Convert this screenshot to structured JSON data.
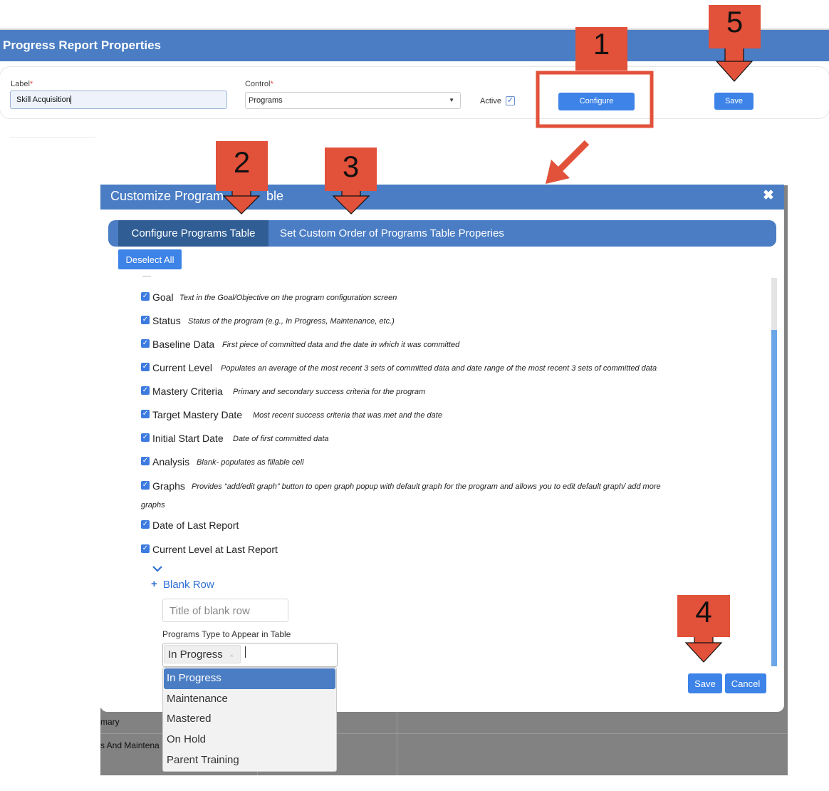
{
  "header": {
    "title": "Progress Report Properties"
  },
  "form": {
    "label_label": "Label",
    "label_value": "Skill Acquisition",
    "control_label": "Control",
    "control_value": "Programs",
    "required_mark": "*",
    "active_label": "Active",
    "active_checked": true,
    "configure_label": "Configure",
    "save_label": "Save"
  },
  "modal": {
    "title": "Customize Programs Table",
    "title_visible_left": "Customize Program",
    "title_visible_right": "ble",
    "close_glyph": "✖",
    "tabs": [
      {
        "label": "Configure Programs Table",
        "active": true
      },
      {
        "label": "Set Custom Order of Programs Table Properies",
        "active": false
      }
    ],
    "deselect_all_label": "Deselect All",
    "items": [
      {
        "name": "Goal",
        "desc": "Text in the Goal/Objective on the program configuration screen",
        "checked": true
      },
      {
        "name": "Status",
        "desc": "Status of the program (e.g., In Progress, Maintenance, etc.)",
        "checked": true
      },
      {
        "name": "Baseline Data",
        "desc": "First piece of committed data and the date in which it was committed",
        "checked": true
      },
      {
        "name": "Current Level",
        "desc": "Populates an average of the most recent 3 sets of committed data and date range of the most recent 3 sets of committed data",
        "checked": true
      },
      {
        "name": "Mastery Criteria",
        "desc": "Primary and secondary success criteria for the program",
        "checked": true
      },
      {
        "name": "Target Mastery Date",
        "desc": "Most recent success criteria that was met and the date",
        "checked": true
      },
      {
        "name": "Initial Start Date",
        "desc": "Date of first committed data",
        "checked": true
      },
      {
        "name": "Analysis",
        "desc": "Blank- populates as fillable cell",
        "checked": true
      },
      {
        "name": "Graphs",
        "desc": "Provides “add/edit graph” button to open graph popup with default graph for the program and allows you to edit default graph/ add more",
        "desc_cont": "graphs",
        "checked": true
      },
      {
        "name": "Date of Last Report",
        "desc": "",
        "checked": true
      },
      {
        "name": "Current Level at Last Report",
        "desc": "",
        "checked": true
      }
    ],
    "chevron_glyph": "⌄",
    "blank_row_label": "Blank Row",
    "plus_glyph": "+",
    "blank_row_placeholder": "Title of blank row",
    "programs_type_label": "Programs Type to Appear in Table",
    "programs_type_selected": "In Progress",
    "dropdown_options": [
      "In Progress",
      "Maintenance",
      "Mastered",
      "On Hold",
      "Parent Training"
    ],
    "dropdown_highlighted": "In Progress",
    "save_label": "Save",
    "cancel_label": "Cancel"
  },
  "background": {
    "row_texts": [
      "mary",
      "s And Maintena"
    ]
  },
  "annotations": [
    "1",
    "2",
    "3",
    "4",
    "5"
  ],
  "colors": {
    "header_blue": "#4a7dc4",
    "active_tab": "#2f5d94",
    "button_blue": "#3d83e8",
    "annotation_red": "#e2513a",
    "overlay_gray": "#828282"
  }
}
